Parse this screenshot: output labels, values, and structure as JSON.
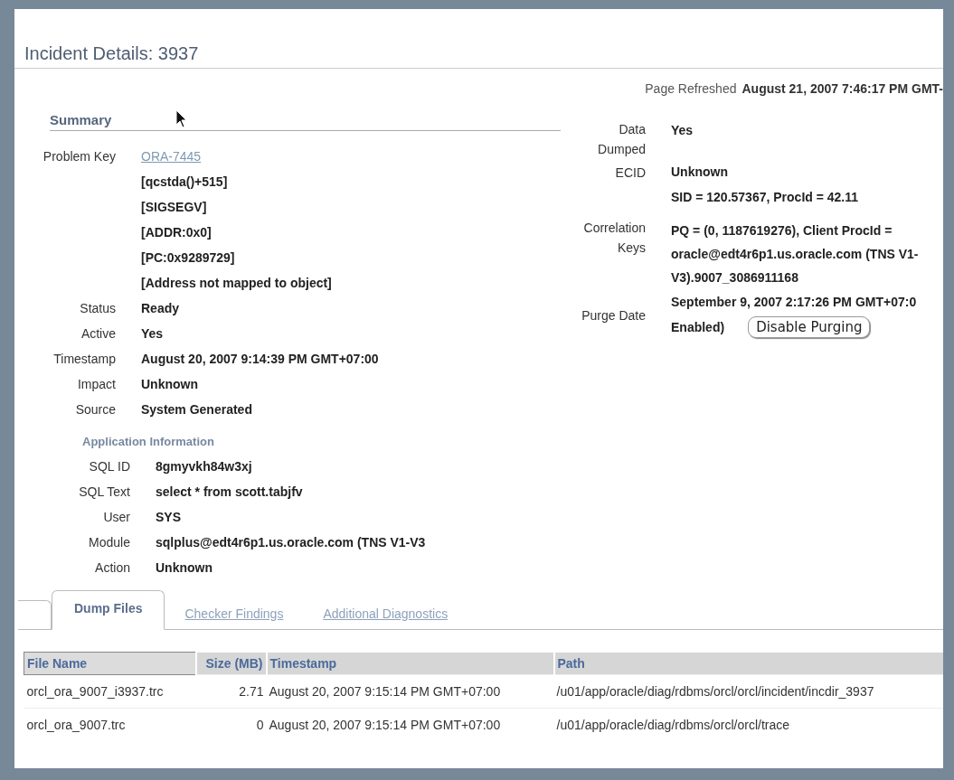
{
  "page": {
    "title": "Incident Details: 3937",
    "refreshed_label": "Page Refreshed",
    "refreshed_value": "August 21, 2007 7:46:17 PM GMT-"
  },
  "summary": {
    "heading": "Summary",
    "fields": [
      {
        "label": "Problem Key",
        "kind": "link",
        "values": [
          "ORA-7445",
          "[qcstda()+515]",
          "[SIGSEGV]",
          "[ADDR:0x0]",
          "[PC:0x9289729]",
          "[Address not mapped to object]"
        ]
      },
      {
        "label": "Status",
        "kind": "text",
        "values": [
          "Ready"
        ]
      },
      {
        "label": "Active",
        "kind": "text",
        "values": [
          "Yes"
        ]
      },
      {
        "label": "Timestamp",
        "kind": "text",
        "values": [
          "August 20, 2007 9:14:39 PM GMT+07:00"
        ]
      },
      {
        "label": "Impact",
        "kind": "text",
        "values": [
          "Unknown"
        ]
      },
      {
        "label": "Source",
        "kind": "text",
        "values": [
          "System Generated"
        ]
      }
    ]
  },
  "application_information": {
    "heading": "Application Information",
    "fields": [
      {
        "label": "SQL ID",
        "kind": "text",
        "values": [
          "8gmyvkh84w3xj"
        ]
      },
      {
        "label": "SQL Text",
        "kind": "text",
        "values": [
          "select * from scott.tabjfv"
        ]
      },
      {
        "label": "User",
        "kind": "text",
        "values": [
          "SYS"
        ]
      },
      {
        "label": "Module",
        "kind": "text",
        "values": [
          "sqlplus@edt4r6p1.us.oracle.com (TNS V1-V3"
        ]
      },
      {
        "label": "Action",
        "kind": "text",
        "values": [
          "Unknown"
        ]
      }
    ]
  },
  "details": {
    "fields": [
      {
        "label": "Data Dumped",
        "kind": "text",
        "values": [
          "Yes"
        ]
      },
      {
        "label": "ECID",
        "kind": "text",
        "values": [
          "Unknown"
        ]
      },
      {
        "label": "Correlation Keys",
        "kind": "text",
        "values": [
          "SID = 120.57367, ProcId = 42.11",
          "PQ = (0, 1187619276), Client ProcId = oracle@edt4r6p1.us.oracle.com (TNS V1-V3).9007_3086911168"
        ]
      },
      {
        "label": "Purge Date",
        "kind": "button",
        "values": [
          "September 9, 2007 2:17:26 PM GMT+07:0",
          "Enabled)"
        ],
        "button": "Disable Purging"
      }
    ]
  },
  "tabs": [
    {
      "label": "Dump Files",
      "selected": true
    },
    {
      "label": "Checker Findings",
      "selected": false
    },
    {
      "label": "Additional Diagnostics",
      "selected": false
    }
  ],
  "table": {
    "columns": [
      "File Name",
      "Size (MB)",
      "Timestamp",
      "Path"
    ],
    "rows": [
      [
        "orcl_ora_9007_i3937.trc",
        "2.71",
        "August 20, 2007 9:15:14 PM GMT+07:00",
        "/u01/app/oracle/diag/rdbms/orcl/orcl/incident/incdir_3937"
      ],
      [
        "orcl_ora_9007.trc",
        "0",
        "August 20, 2007 9:15:14 PM GMT+07:00",
        "/u01/app/oracle/diag/rdbms/orcl/orcl/trace"
      ]
    ]
  }
}
